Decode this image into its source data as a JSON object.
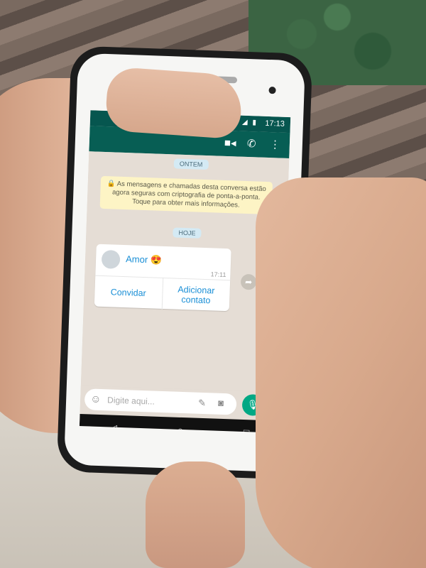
{
  "status": {
    "time": "17:13",
    "icons": "▼◢ ▮"
  },
  "toolbar": {
    "video_icon": "video-call-icon",
    "call_icon": "phone-icon",
    "menu_icon": "more-vert-icon"
  },
  "chat": {
    "date_yesterday": "ONTEM",
    "encryption_notice": "🔒 As mensagens e chamadas desta conversa estão agora seguras com criptografia de ponta-a-ponta. Toque para obter mais informações.",
    "date_today": "HOJE",
    "contact_card": {
      "name": "Amor 😍",
      "time": "17:11",
      "actions": [
        "Convidar",
        "Adicionar contato"
      ]
    }
  },
  "input": {
    "placeholder": "Digite aqui..."
  },
  "navbar": {
    "back": "◁",
    "home": "○",
    "recents": "□"
  },
  "colors": {
    "header": "#075e54",
    "accent": "#1a8fd6",
    "mic": "#00a884",
    "notice": "#fdf4c5"
  }
}
